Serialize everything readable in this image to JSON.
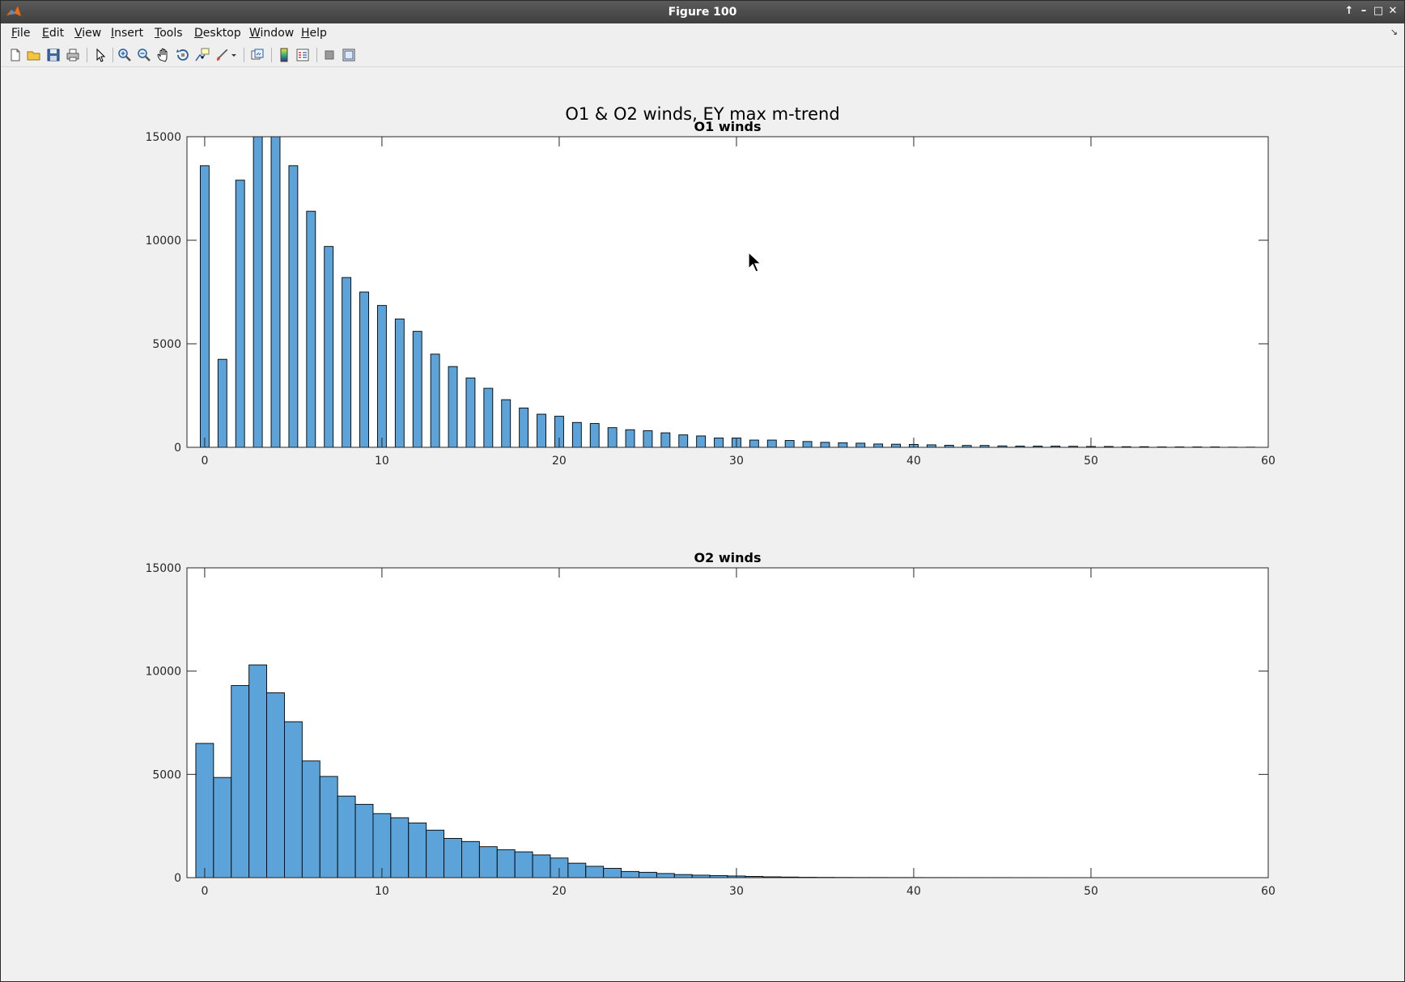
{
  "window": {
    "title": "Figure 100",
    "controls": [
      "↑",
      "–",
      "□",
      "✕"
    ]
  },
  "menu": [
    "File",
    "Edit",
    "View",
    "Insert",
    "Tools",
    "Desktop",
    "Window",
    "Help"
  ],
  "toolbar": {
    "buttons": [
      "new-figure",
      "open-file",
      "save",
      "print",
      "edit-plot",
      "zoom-in",
      "zoom-out",
      "pan",
      "rotate-3d",
      "data-cursor",
      "brush",
      "link-plot",
      "insert-colorbar",
      "insert-legend",
      "hide-plot-tools",
      "show-plot-tools"
    ]
  },
  "colors": {
    "bar_fill": "#5ba3d9",
    "bar_edge": "#000000"
  },
  "figure": {
    "suptitle": "O1 & O2 winds, EY max m-trend"
  },
  "chart_data": [
    {
      "type": "bar",
      "title": "O1 winds",
      "xlim": [
        -1,
        60
      ],
      "ylim": [
        0,
        15000
      ],
      "xticks": [
        0,
        10,
        20,
        30,
        40,
        50,
        60
      ],
      "yticks": [
        0,
        5000,
        10000,
        15000
      ],
      "bar_width": 0.5,
      "x": [
        0,
        1,
        2,
        3,
        4,
        5,
        6,
        7,
        8,
        9,
        10,
        11,
        12,
        13,
        14,
        15,
        16,
        17,
        18,
        19,
        20,
        21,
        22,
        23,
        24,
        25,
        26,
        27,
        28,
        29,
        30,
        31,
        32,
        33,
        34,
        35,
        36,
        37,
        38,
        39,
        40,
        41,
        42,
        43,
        44,
        45,
        46,
        47,
        48,
        49,
        50,
        51,
        52,
        53,
        54,
        55,
        56,
        57,
        58,
        59
      ],
      "values": [
        13600,
        4250,
        12900,
        15000,
        15000,
        13600,
        11400,
        9700,
        8200,
        7500,
        6850,
        6200,
        5600,
        4500,
        3900,
        3350,
        2850,
        2300,
        1900,
        1600,
        1500,
        1200,
        1150,
        950,
        850,
        800,
        700,
        600,
        550,
        450,
        450,
        350,
        350,
        330,
        280,
        240,
        220,
        200,
        160,
        150,
        140,
        120,
        100,
        90,
        90,
        70,
        60,
        60,
        60,
        50,
        40,
        40,
        30,
        30,
        20,
        20,
        20,
        20,
        10,
        10
      ]
    },
    {
      "type": "bar",
      "title": "O2 winds",
      "xlim": [
        -1,
        60
      ],
      "ylim": [
        0,
        15000
      ],
      "xticks": [
        0,
        10,
        20,
        30,
        40,
        50,
        60
      ],
      "yticks": [
        0,
        5000,
        10000,
        15000
      ],
      "bar_width": 1,
      "x": [
        0,
        1,
        2,
        3,
        4,
        5,
        6,
        7,
        8,
        9,
        10,
        11,
        12,
        13,
        14,
        15,
        16,
        17,
        18,
        19,
        20,
        21,
        22,
        23,
        24,
        25,
        26,
        27,
        28,
        29,
        30,
        31,
        32,
        33,
        34,
        35,
        36,
        37,
        38,
        39,
        40,
        41,
        42,
        43,
        44,
        45,
        46,
        47,
        48,
        49,
        50
      ],
      "values": [
        6500,
        4850,
        9300,
        10300,
        8950,
        7550,
        5650,
        4900,
        3950,
        3550,
        3100,
        2900,
        2650,
        2300,
        1900,
        1750,
        1500,
        1350,
        1250,
        1100,
        950,
        700,
        550,
        450,
        300,
        260,
        200,
        150,
        120,
        100,
        80,
        60,
        40,
        30,
        20,
        15,
        12,
        10,
        10,
        8,
        8,
        6,
        6,
        5,
        5,
        5,
        4,
        4,
        3,
        3,
        3
      ]
    }
  ]
}
